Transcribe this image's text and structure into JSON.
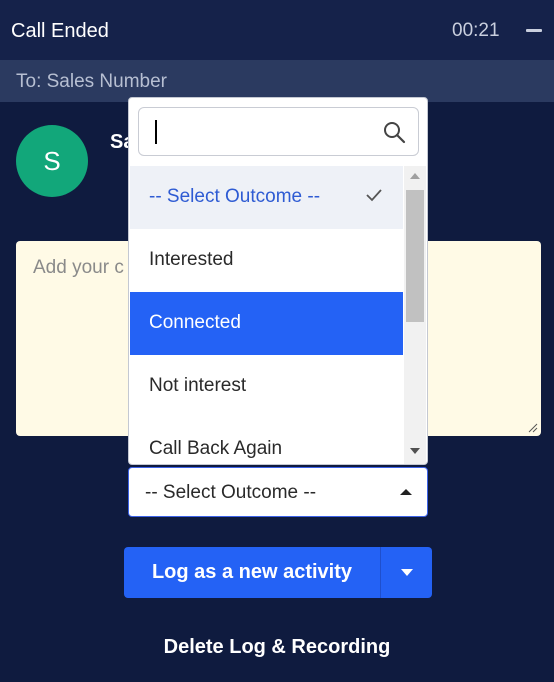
{
  "header": {
    "title": "Call Ended",
    "timer": "00:21"
  },
  "recipient": {
    "text": "To: Sales Number"
  },
  "contact": {
    "avatar_initial": "S",
    "name_partial": "Sa"
  },
  "notes": {
    "placeholder_partial": "Add your c"
  },
  "outcome_select": {
    "value": "-- Select Outcome --",
    "search": {
      "value": "",
      "icon": "search-icon"
    },
    "options": [
      {
        "label": "-- Select Outcome --",
        "state": "selected"
      },
      {
        "label": "Interested",
        "state": "normal"
      },
      {
        "label": "Connected",
        "state": "highlighted"
      },
      {
        "label": "Not interest",
        "state": "normal"
      },
      {
        "label": "Call Back Again",
        "state": "normal"
      }
    ]
  },
  "actions": {
    "log_label": "Log as a new activity",
    "delete_label": "Delete Log & Recording"
  },
  "colors": {
    "background": "#0f1b3f",
    "header": "#15224a",
    "accent": "#2462f5",
    "avatar": "#12a77a",
    "notes_bg": "#fffae6"
  }
}
